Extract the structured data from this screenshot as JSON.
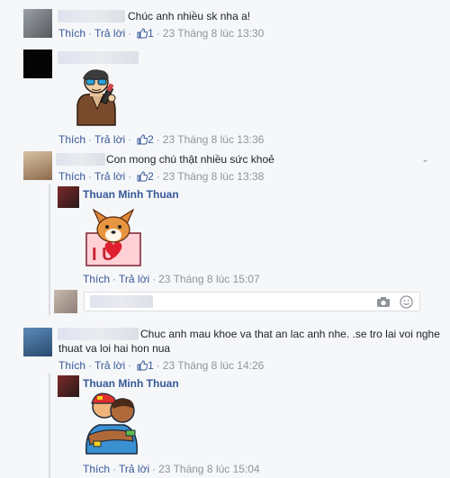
{
  "comments": [
    {
      "text": "Chúc anh nhiều sk nha a!",
      "actions": {
        "like": "Thích",
        "reply": "Trả lời",
        "likes": "1",
        "time": "23 Tháng 8 lúc 13:30"
      }
    },
    {
      "actions": {
        "like": "Thích",
        "reply": "Trả lời",
        "likes": "2",
        "time": "23 Tháng 8 lúc 13:36"
      }
    },
    {
      "text": "Con mong chú thật nhiều sức khoẻ",
      "actions": {
        "like": "Thích",
        "reply": "Trả lời",
        "likes": "2",
        "time": "23 Tháng 8 lúc 13:38"
      },
      "reply": {
        "name": "Thuan Minh Thuan",
        "actions": {
          "like": "Thích",
          "reply": "Trả lời",
          "time": "23 Tháng 8 lúc 15:07"
        }
      }
    },
    {
      "text_line1": "Chuc anh mau khoe va that an lac anh nhe. .se tro lai voi nghe",
      "text_line2": "thuat va loi hai hon nua",
      "actions": {
        "like": "Thích",
        "reply": "Trả lời",
        "likes": "1",
        "time": "23 Tháng 8 lúc 14:26"
      },
      "reply": {
        "name": "Thuan Minh Thuan",
        "actions": {
          "like": "Thích",
          "reply": "Trả lời",
          "time": "23 Tháng 8 lúc 15:04"
        }
      }
    }
  ],
  "sticker_text": "I U",
  "colors": {
    "link": "#365899",
    "meta": "#90949c",
    "bg": "#f6f7f9"
  }
}
